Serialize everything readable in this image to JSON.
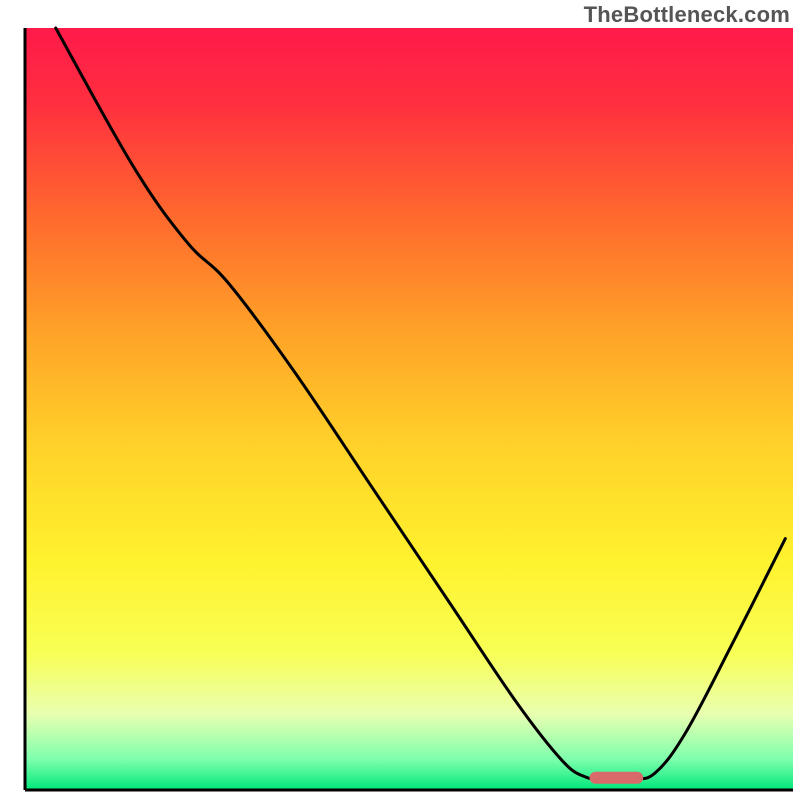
{
  "watermark": "TheBottleneck.com",
  "chart_data": {
    "type": "line",
    "title": "",
    "xlabel": "",
    "ylabel": "",
    "xlim": [
      0,
      100
    ],
    "ylim": [
      0,
      100
    ],
    "background_gradient": {
      "stops": [
        {
          "offset": 0.0,
          "color": "#ff1a4a"
        },
        {
          "offset": 0.1,
          "color": "#ff2f3f"
        },
        {
          "offset": 0.25,
          "color": "#ff6a2d"
        },
        {
          "offset": 0.4,
          "color": "#ffa328"
        },
        {
          "offset": 0.55,
          "color": "#ffd229"
        },
        {
          "offset": 0.7,
          "color": "#fff22e"
        },
        {
          "offset": 0.82,
          "color": "#f8ff55"
        },
        {
          "offset": 0.9,
          "color": "#e9ffb0"
        },
        {
          "offset": 0.96,
          "color": "#7dffad"
        },
        {
          "offset": 1.0,
          "color": "#00e77a"
        }
      ]
    },
    "series": [
      {
        "name": "bottleneck-curve",
        "color": "#000000",
        "points": [
          {
            "x": 4.0,
            "y": 100.0
          },
          {
            "x": 14.0,
            "y": 82.0
          },
          {
            "x": 21.0,
            "y": 72.0
          },
          {
            "x": 26.5,
            "y": 66.5
          },
          {
            "x": 35.0,
            "y": 55.0
          },
          {
            "x": 45.0,
            "y": 40.0
          },
          {
            "x": 55.0,
            "y": 25.0
          },
          {
            "x": 64.0,
            "y": 11.5
          },
          {
            "x": 70.0,
            "y": 3.8
          },
          {
            "x": 73.0,
            "y": 1.7
          },
          {
            "x": 75.0,
            "y": 1.5
          },
          {
            "x": 79.0,
            "y": 1.5
          },
          {
            "x": 82.0,
            "y": 2.2
          },
          {
            "x": 86.0,
            "y": 7.5
          },
          {
            "x": 92.0,
            "y": 19.0
          },
          {
            "x": 99.0,
            "y": 33.0
          }
        ]
      }
    ],
    "marker": {
      "name": "optimal-marker",
      "x_start": 73.5,
      "x_end": 80.5,
      "y": 1.6,
      "color": "#d96a6a"
    },
    "axes": {
      "color": "#000000",
      "width": 3
    }
  }
}
